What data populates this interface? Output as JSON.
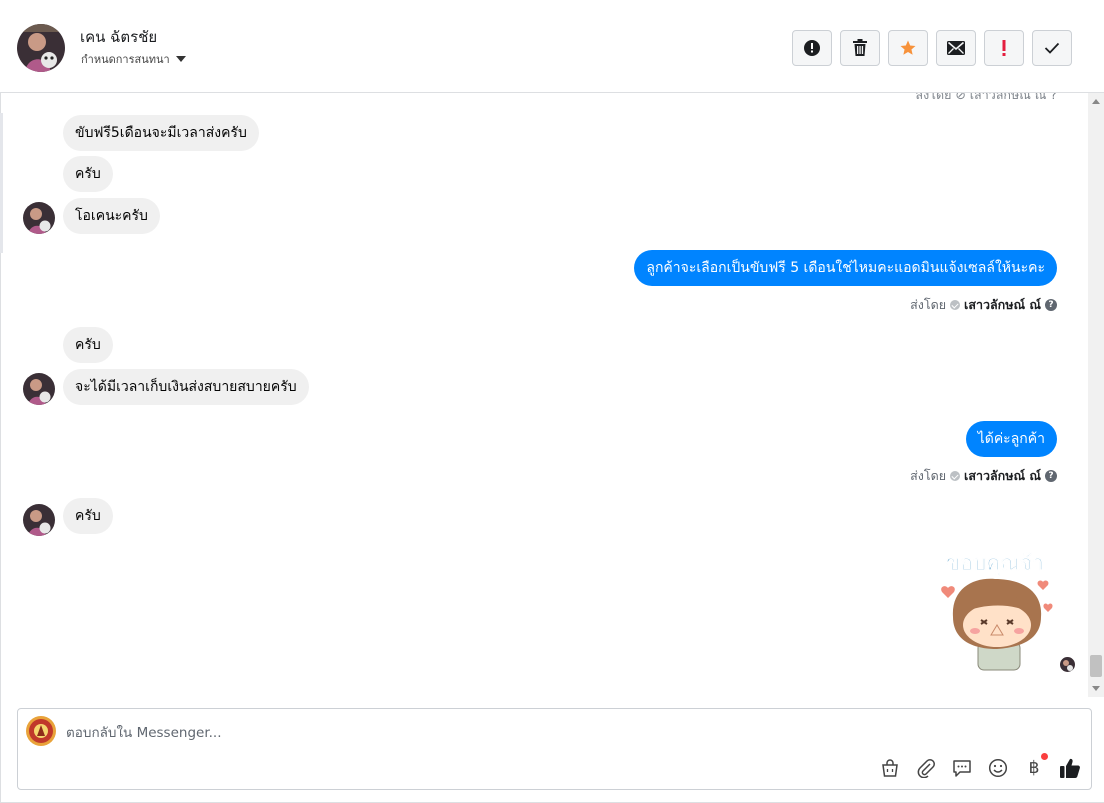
{
  "header": {
    "contact_name": "เคน ฉัตรชัย",
    "assign_label": "กำหนดการสนทนา",
    "actions": [
      {
        "name": "report-spam-button",
        "icon": "alert-circle-icon"
      },
      {
        "name": "delete-button",
        "icon": "trash-icon"
      },
      {
        "name": "star-button",
        "icon": "star-icon",
        "color": "#f7923b"
      },
      {
        "name": "mark-unread-button",
        "icon": "envelope-icon"
      },
      {
        "name": "mark-important-button",
        "icon": "exclamation-icon",
        "color": "#e41e3f"
      },
      {
        "name": "mark-done-button",
        "icon": "checkmark-icon"
      }
    ]
  },
  "thread": {
    "clipped_top_label": "ส่งโดย ⊘ เสาวลักษณ์ ณ์ ?",
    "messages": [
      {
        "side": "in",
        "text": "ขับฟรี5เดือนจะมีเวลาส่งครับ"
      },
      {
        "side": "in",
        "text": "ครับ"
      },
      {
        "side": "in",
        "text": "โอเคนะครับ"
      },
      {
        "side": "out",
        "text": "ลูกค้าจะเลือกเป็นขับฟรี 5 เดือนใช่ไหมคะแอดมินแจ้งเซลล์ให้นะคะ"
      },
      {
        "side": "in",
        "text": "ครับ"
      },
      {
        "side": "in",
        "text": "จะได้มีเวลาเก็บเงินส่งสบายสบายครับ"
      },
      {
        "side": "out",
        "text": "ได้ค่ะลูกค้า"
      },
      {
        "side": "in",
        "text": "ครับ"
      }
    ],
    "sent_by_prefix": "ส่งโดย",
    "sent_by_name": "เสาวลักษณ์ ณ์",
    "help_glyph": "?",
    "sticker_text": "ขอบคุณจ้า"
  },
  "composer": {
    "placeholder": "ตอบกลับใน Messenger...",
    "tools": [
      {
        "name": "shop-bag-button",
        "icon": "shopping-bag-icon"
      },
      {
        "name": "attach-button",
        "icon": "paperclip-icon"
      },
      {
        "name": "saved-replies-button",
        "icon": "chat-bubble-icon"
      },
      {
        "name": "emoji-button",
        "icon": "smiley-icon"
      },
      {
        "name": "payment-button",
        "icon": "baht-icon",
        "glyph": "฿"
      },
      {
        "name": "like-button",
        "icon": "thumbs-up-icon"
      }
    ]
  },
  "colors": {
    "outgoing_bubble": "#0084ff",
    "incoming_bubble": "#f0f0f0",
    "star": "#f7923b",
    "alert": "#e41e3f"
  }
}
